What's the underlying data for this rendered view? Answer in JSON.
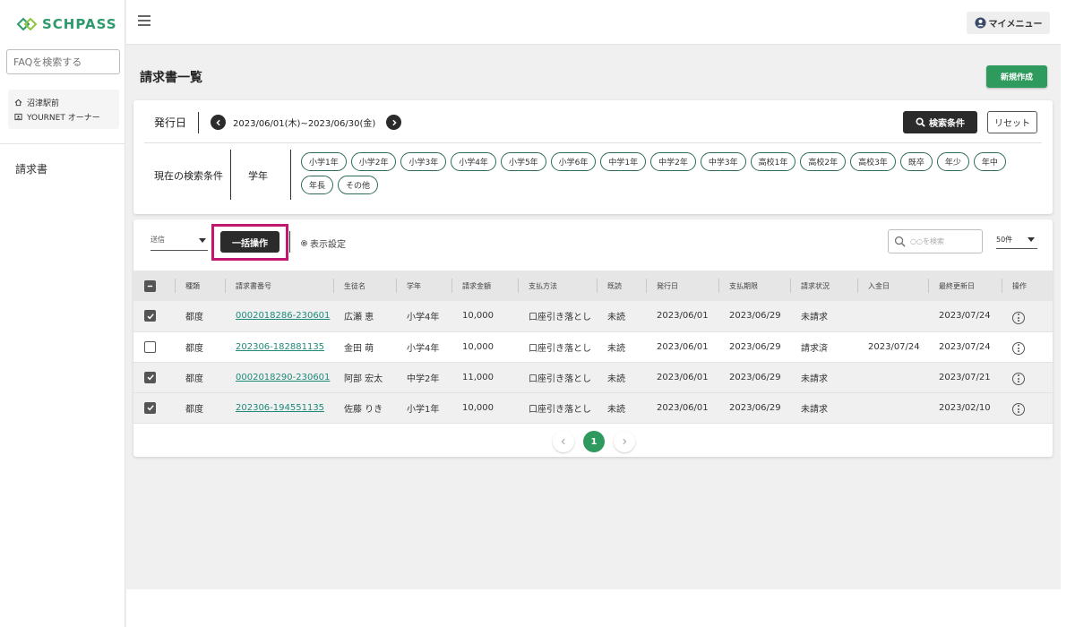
{
  "app": {
    "brand": "SCHPASS",
    "brand_color": "#2e9a6e"
  },
  "sidebar": {
    "faq_placeholder": "FAQを検索する",
    "school_name": "沼津駅前",
    "owner": "YOURNET オーナー",
    "nav": [
      {
        "label": "請求書"
      }
    ]
  },
  "header": {
    "my_menu": "マイメニュー"
  },
  "page": {
    "title": "請求書一覧",
    "new_button": "新規作成"
  },
  "filter": {
    "date_label": "発行日",
    "date_range": "2023/06/01(木)~2023/06/30(金)",
    "search_button": "検索条件",
    "reset_button": "リセット",
    "current_label": "現在の検索条件",
    "condition_key": "学年",
    "chips": [
      "小学1年",
      "小学2年",
      "小学3年",
      "小学4年",
      "小学5年",
      "小学6年",
      "中学1年",
      "中学2年",
      "中学3年",
      "高校1年",
      "高校2年",
      "高校3年",
      "既卒",
      "年少",
      "年中",
      "年長",
      "その他"
    ]
  },
  "toolbar": {
    "send_select": "送信",
    "bulk_button": "一括操作",
    "display_settings": "表示設定",
    "search_placeholder": "○○を検索",
    "per_page": "50件"
  },
  "table": {
    "headers": [
      "種類",
      "請求書番号",
      "生徒名",
      "学年",
      "請求金額",
      "支払方法",
      "既読",
      "発行日",
      "支払期限",
      "請求状況",
      "入金日",
      "最終更新日",
      "操作"
    ],
    "rows": [
      {
        "checked": true,
        "type": "都度",
        "invoice_no": "0002018286-230601",
        "student": "広瀬 恵",
        "grade": "小学4年",
        "amount": "10,000",
        "payment": "口座引き落とし",
        "read": "未読",
        "issued": "2023/06/01",
        "due": "2023/06/29",
        "status": "未請求",
        "paid_date": "",
        "updated": "2023/07/24"
      },
      {
        "checked": false,
        "type": "都度",
        "invoice_no": "202306-182881135",
        "student": "金田 萌",
        "grade": "小学4年",
        "amount": "10,000",
        "payment": "口座引き落とし",
        "read": "未読",
        "issued": "2023/06/01",
        "due": "2023/06/29",
        "status": "請求済",
        "paid_date": "2023/07/24",
        "updated": "2023/07/24"
      },
      {
        "checked": true,
        "type": "都度",
        "invoice_no": "0002018290-230601",
        "student": "阿部 宏太",
        "grade": "中学2年",
        "amount": "11,000",
        "payment": "口座引き落とし",
        "read": "未読",
        "issued": "2023/06/01",
        "due": "2023/06/29",
        "status": "未請求",
        "paid_date": "",
        "updated": "2023/07/21"
      },
      {
        "checked": true,
        "type": "都度",
        "invoice_no": "202306-194551135",
        "student": "佐藤 りき",
        "grade": "小学1年",
        "amount": "10,000",
        "payment": "口座引き落とし",
        "read": "未読",
        "issued": "2023/06/01",
        "due": "2023/06/29",
        "status": "未請求",
        "paid_date": "",
        "updated": "2023/02/10"
      }
    ]
  },
  "pagination": {
    "current": "1",
    "prev_icon": "chevron-left-icon",
    "next_icon": "chevron-right-icon"
  }
}
